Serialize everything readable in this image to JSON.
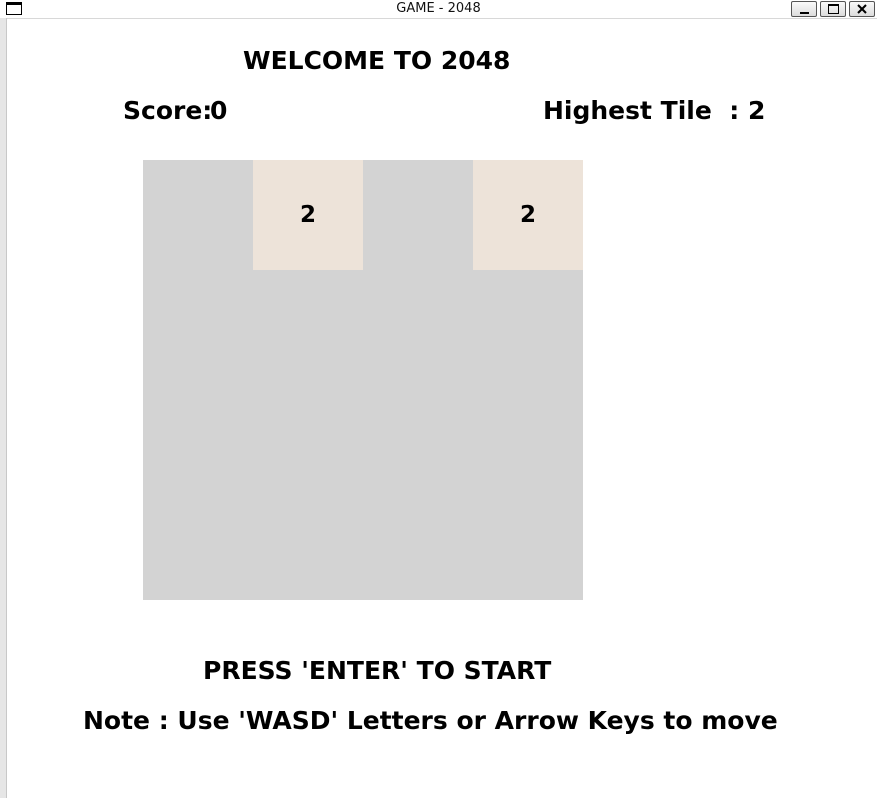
{
  "window": {
    "title": "GAME - 2048"
  },
  "header": {
    "welcome": "WELCOME TO 2048",
    "score_label": "Score:",
    "score_value": "0",
    "highest_label": "Highest Tile  :",
    "highest_value": "2"
  },
  "board": {
    "size": 4,
    "empty_color": "#d3d3d3",
    "tile_color_2": "#ede3d9",
    "cells": [
      [
        null,
        2,
        null,
        2
      ],
      [
        null,
        null,
        null,
        null
      ],
      [
        null,
        null,
        null,
        null
      ],
      [
        null,
        null,
        null,
        null
      ]
    ]
  },
  "footer": {
    "start_prompt": "PRESS 'ENTER' TO START",
    "note": "Note : Use 'WASD' Letters or Arrow Keys to move"
  }
}
